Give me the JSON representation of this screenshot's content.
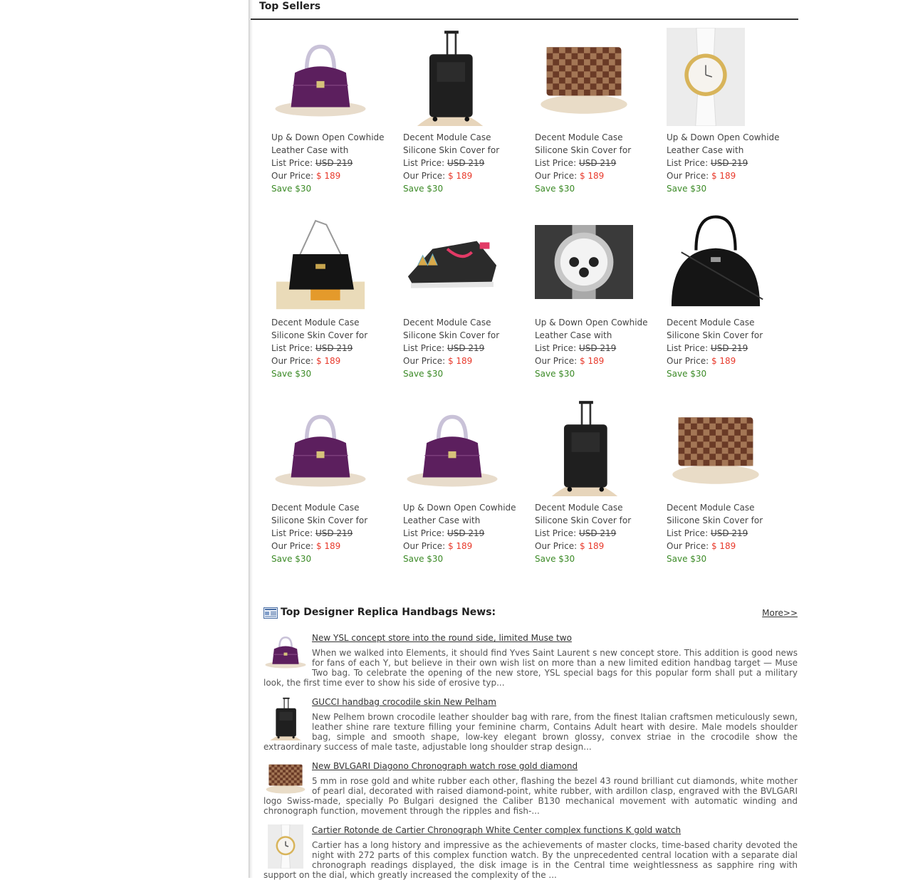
{
  "top_sellers": {
    "title": "Top Sellers",
    "products": [
      {
        "name": "Up & Down Open Cowhide Leather Case with Crocodile...",
        "list_label": "List Price:",
        "list_price": "USD 219",
        "our_label": "Our Price:",
        "our_price": "$ 189",
        "save": "Save $30",
        "image": "purple-handbag"
      },
      {
        "name": "Decent Module Case Silicone Skin Cover for iPhone ...",
        "list_label": "List Price:",
        "list_price": "USD 219",
        "our_label": "Our Price:",
        "our_price": "$ 189",
        "save": "Save $30",
        "image": "black-luggage"
      },
      {
        "name": "Decent Module Case Silicone Skin Cover for iPhone ...",
        "list_label": "List Price:",
        "list_price": "USD 219",
        "our_label": "Our Price:",
        "our_price": "$ 189",
        "save": "Save $30",
        "image": "checker-case"
      },
      {
        "name": "Up & Down Open Cowhide Leather Case with Crocodile...",
        "list_label": "List Price:",
        "list_price": "USD 219",
        "our_label": "Our Price:",
        "our_price": "$ 189",
        "save": "Save $30",
        "image": "gold-watch"
      },
      {
        "name": "Decent Module Case Silicone Skin Cover for iPhone ...",
        "list_label": "List Price:",
        "list_price": "USD 219",
        "our_label": "Our Price:",
        "our_price": "$ 189",
        "save": "Save $30",
        "image": "black-shoulder-bag"
      },
      {
        "name": "Decent Module Case Silicone Skin Cover for iPhone ...",
        "list_label": "List Price:",
        "list_price": "USD 219",
        "our_label": "Our Price:",
        "our_price": "$ 189",
        "save": "Save $30",
        "image": "spiked-sneaker"
      },
      {
        "name": "Up & Down Open Cowhide Leather Case with Crocodile...",
        "list_label": "List Price:",
        "list_price": "USD 219",
        "our_label": "Our Price:",
        "our_price": "$ 189",
        "save": "Save $30",
        "image": "silver-watch"
      },
      {
        "name": "Decent Module Case Silicone Skin Cover for iPhone ...",
        "list_label": "List Price:",
        "list_price": "USD 219",
        "our_label": "Our Price:",
        "our_price": "$ 189",
        "save": "Save $30",
        "image": "black-tote"
      },
      {
        "name": "Decent Module Case Silicone Skin Cover for iPhone ...",
        "list_label": "List Price:",
        "list_price": "USD 219",
        "our_label": "Our Price:",
        "our_price": "$ 189",
        "save": "Save $30",
        "image": "purple-handbag"
      },
      {
        "name": "Up & Down Open Cowhide Leather Case with Crocodile...",
        "list_label": "List Price:",
        "list_price": "USD 219",
        "our_label": "Our Price:",
        "our_price": "$ 189",
        "save": "Save $30",
        "image": "purple-handbag"
      },
      {
        "name": "Decent Module Case Silicone Skin Cover for iPhone ...",
        "list_label": "List Price:",
        "list_price": "USD 219",
        "our_label": "Our Price:",
        "our_price": "$ 189",
        "save": "Save $30",
        "image": "black-luggage"
      },
      {
        "name": "Decent Module Case Silicone Skin Cover for iPhone ...",
        "list_label": "List Price:",
        "list_price": "USD 219",
        "our_label": "Our Price:",
        "our_price": "$ 189",
        "save": "Save $30",
        "image": "checker-case"
      }
    ]
  },
  "news": {
    "title": "Top Designer Replica Handbags News:",
    "more": "More>>",
    "items": [
      {
        "title": "New YSL concept store into the round side, limited Muse two",
        "text": "When we walked into Elements, it should find Yves Saint Laurent s new concept store. This addition is good news for fans of each Y, but believe in their own wish list on more than a new limited edition handbag target — Muse Two bag. To celebrate the opening of the new store, YSL special bags for this popular form shall put a military look, the first time ever to show his side of erosive typ...",
        "image": "purple-handbag"
      },
      {
        "title": "GUCCI handbag crocodile skin New Pelham",
        "text": "New Pelhem brown crocodile leather shoulder bag with rare, from the finest Italian craftsmen meticulously sewn, leather shine rare texture filling your feminine charm, Contains Adult heart with desire. Male models shoulder bag, simple and smooth shape, low-key elegant brown glossy, convex striae in the crocodile show the extraordinary success of male taste, adjustable long shoulder strap design...",
        "image": "black-luggage"
      },
      {
        "title": "New BVLGARI Diagono Chronograph watch rose gold diamond",
        "text": "5 mm in rose gold and white rubber each other, flashing the bezel 43 round brilliant cut diamonds, white mother of pearl dial, decorated with raised diamond-point, white rubber, with ardillon clasp, engraved with the BVLGARI logo Swiss-made, specially Po Bulgari designed the Caliber B130 mechanical movement with automatic winding and chronograph function, movement through the ripples and fish-...",
        "image": "checker-case"
      },
      {
        "title": "Cartier Rotonde de Cartier Chronograph White Center complex functions K gold watch",
        "text": "Cartier has a long history and impressive as the achievements of master clocks, time-based charity devoted the night with 272 parts of this complex function watch. By the unprecedented central location with a separate dial chronograph readings displayed, the disk image is in the Central time weightlessness as sapphire ring with support on the dial, which greatly increased the complexity of the ...",
        "image": "gold-watch"
      }
    ]
  }
}
